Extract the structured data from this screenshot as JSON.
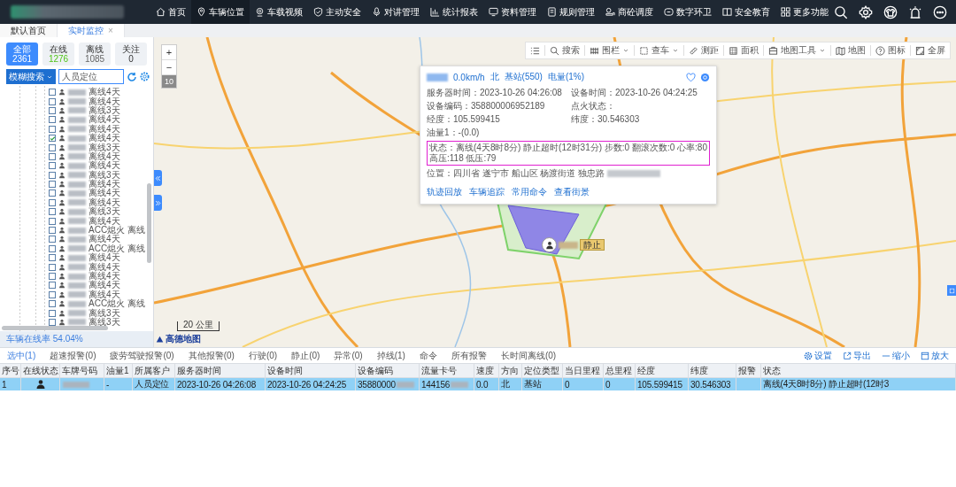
{
  "header": {
    "nav": [
      {
        "label": "首页",
        "selected": false
      },
      {
        "label": "车辆位置",
        "selected": true
      },
      {
        "label": "车载视频",
        "selected": false
      },
      {
        "label": "主动安全",
        "selected": false
      },
      {
        "label": "对讲管理",
        "selected": false
      },
      {
        "label": "统计报表",
        "selected": false
      },
      {
        "label": "资料管理",
        "selected": false
      },
      {
        "label": "规则管理",
        "selected": false
      },
      {
        "label": "商砼调度",
        "selected": false
      },
      {
        "label": "数字环卫",
        "selected": false
      },
      {
        "label": "安全教育",
        "selected": false
      },
      {
        "label": "更多功能",
        "selected": false
      }
    ]
  },
  "page_tabs": [
    {
      "label": "默认首页",
      "selected": false
    },
    {
      "label": "实时监控",
      "selected": true,
      "close": "×"
    }
  ],
  "vehicle_panel": {
    "filters": [
      {
        "label": "全部",
        "count": "2361",
        "selected": true,
        "color": "#ffffff"
      },
      {
        "label": "在线",
        "count": "1276",
        "selected": false,
        "color": "#52c41a"
      },
      {
        "label": "离线",
        "count": "1085",
        "selected": false,
        "color": "#666666"
      },
      {
        "label": "关注",
        "count": "0",
        "selected": false
      }
    ],
    "search": {
      "mode": "模糊搜索",
      "value": "人员定位"
    },
    "tree": [
      {
        "status": "离线4天",
        "checked": false
      },
      {
        "status": "离线4天",
        "checked": false
      },
      {
        "status": "离线3天",
        "checked": false
      },
      {
        "status": "离线4天",
        "checked": false
      },
      {
        "status": "离线4天",
        "checked": false
      },
      {
        "status": "离线4天",
        "checked": true
      },
      {
        "status": "离线3天",
        "checked": false
      },
      {
        "status": "离线4天",
        "checked": false
      },
      {
        "status": "离线4天",
        "checked": false
      },
      {
        "status": "离线3天",
        "checked": false
      },
      {
        "status": "离线4天",
        "checked": false
      },
      {
        "status": "离线4天",
        "checked": false
      },
      {
        "status": "离线4天",
        "checked": false
      },
      {
        "status": "离线3天",
        "checked": false
      },
      {
        "status": "离线4天",
        "checked": false
      },
      {
        "status": "ACC熄火 离线",
        "checked": false
      },
      {
        "status": "离线4天",
        "checked": false
      },
      {
        "status": "ACC熄火 离线",
        "checked": false
      },
      {
        "status": "离线4天",
        "checked": false
      },
      {
        "status": "离线4天",
        "checked": false
      },
      {
        "status": "离线4天",
        "checked": false
      },
      {
        "status": "离线4天",
        "checked": false
      },
      {
        "status": "离线4天",
        "checked": false
      },
      {
        "status": "ACC熄火 离线",
        "checked": false
      },
      {
        "status": "离线3天",
        "checked": false
      },
      {
        "status": "离线3天",
        "checked": false
      }
    ],
    "online_rate": "车辆在线率 54.04%"
  },
  "map": {
    "toolbar": [
      {
        "label": "搜索",
        "dropdown": false
      },
      {
        "label": "围栏",
        "dropdown": true
      },
      {
        "label": "查车",
        "dropdown": true
      },
      {
        "label": "测距",
        "dropdown": false
      },
      {
        "label": "面积",
        "dropdown": false
      },
      {
        "label": "地图工具",
        "dropdown": true
      },
      {
        "label": "地图",
        "dropdown": false
      },
      {
        "label": "图标",
        "dropdown": false
      },
      {
        "label": "全屏",
        "dropdown": false
      }
    ],
    "zoom": {
      "in": "+",
      "out": "−",
      "level": "10"
    },
    "scale": "20 公里",
    "logo": "高德地图",
    "marker": {
      "label": "静止"
    },
    "popup": {
      "summary": [
        "0.0km/h",
        "北",
        "基站(550)",
        "电量(1%)"
      ],
      "fields": [
        {
          "label": "服务器时间：",
          "value": "2023-10-26 04:26:08",
          "wide": false,
          "highlighted": false,
          "redacted": false
        },
        {
          "label": "设备时间：",
          "value": "2023-10-26 04:24:25",
          "wide": false,
          "highlighted": false,
          "redacted": false
        },
        {
          "label": "设备编码：",
          "value": "358800006952189",
          "wide": false,
          "highlighted": false,
          "redacted": false
        },
        {
          "label": "点火状态：",
          "wide": false,
          "highlighted": false,
          "redacted": false
        },
        {
          "label": "经度：",
          "value": "105.599415",
          "wide": false,
          "highlighted": false,
          "redacted": false
        },
        {
          "label": "纬度：",
          "value": "30.546303",
          "wide": false,
          "highlighted": false,
          "redacted": false
        },
        {
          "label": "油量1：",
          "value": "-(0.0)",
          "wide": true,
          "highlighted": false,
          "redacted": false
        },
        {
          "label": "状态：",
          "value": "离线(4天8时8分) 静止超时(12时31分) 步数:0 翻滚次数:0 心率:80 高压:118 低压:79",
          "wide": true,
          "highlighted": true,
          "redacted": false
        },
        {
          "label": "位置：",
          "value": "四川省 遂宁市 船山区 杨渡街道 独忠路",
          "wide": true,
          "highlighted": false,
          "redacted": true
        }
      ],
      "links": [
        "轨迹回放",
        "车辆追踪",
        "常用命令",
        "查看街景"
      ]
    }
  },
  "bottom": {
    "tabs": [
      {
        "label": "选中(1)",
        "selected": true
      },
      {
        "label": "超速报警(0)",
        "selected": false
      },
      {
        "label": "疲劳驾驶报警(0)",
        "selected": false
      },
      {
        "label": "其他报警(0)",
        "selected": false
      },
      {
        "label": "行驶(0)",
        "selected": false
      },
      {
        "label": "静止(0)",
        "selected": false
      },
      {
        "label": "异常(0)",
        "selected": false
      },
      {
        "label": "掉线(1)",
        "selected": false
      },
      {
        "label": "命令",
        "selected": false
      },
      {
        "label": "所有报警",
        "selected": false
      },
      {
        "label": "长时间离线(0)",
        "selected": false
      }
    ],
    "actions": [
      "设置",
      "导出",
      "缩小",
      "放大"
    ],
    "table": {
      "columns": [
        "序号",
        "在线状态",
        "车牌号码",
        "油量1",
        "所属客户",
        "服务器时间",
        "设备时间",
        "设备编码",
        "流量卡号",
        "速度",
        "方向",
        "定位类型",
        "当日里程",
        "总里程",
        "经度",
        "纬度",
        "报警",
        "状态"
      ],
      "rows": [
        {
          "selected": true,
          "cells": [
            {
              "kind": "text",
              "text": "1"
            },
            {
              "kind": "avatar"
            },
            {
              "kind": "redacted"
            },
            {
              "kind": "text",
              "text": "-"
            },
            {
              "kind": "text",
              "text": "人员定位"
            },
            {
              "kind": "text",
              "text": "2023-10-26 04:26:08"
            },
            {
              "kind": "text",
              "text": "2023-10-26 04:24:25"
            },
            {
              "kind": "partial",
              "text": "35880000"
            },
            {
              "kind": "partial",
              "text": "144156"
            },
            {
              "kind": "text",
              "text": "0.0"
            },
            {
              "kind": "text",
              "text": "北"
            },
            {
              "kind": "text",
              "text": "基站"
            },
            {
              "kind": "text",
              "text": "0"
            },
            {
              "kind": "text",
              "text": "0"
            },
            {
              "kind": "text",
              "text": "105.599415"
            },
            {
              "kind": "text",
              "text": "30.546303"
            },
            {
              "kind": "empty"
            },
            {
              "kind": "text",
              "text": "离线(4天8时8分) 静止超时(12时3"
            }
          ]
        }
      ]
    }
  }
}
